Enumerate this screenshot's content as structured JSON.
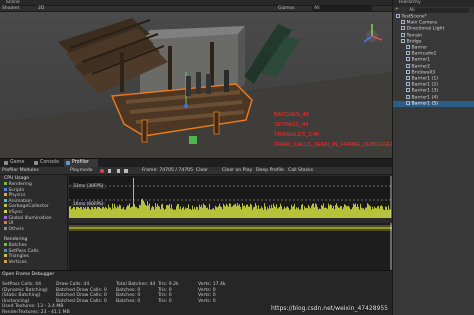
{
  "scene": {
    "tab_label": "Scene",
    "shading_mode": "Shaded",
    "view_mode": "2D",
    "gizmos_label": "Gizmos",
    "search_placeholder": "All",
    "annotations": [
      "BATCHES_48",
      "SETPASS_44",
      "TRIANGLES_3.4K",
      "DRAW_CALLS_SEEN_IN_FRAME_DEBUGGER"
    ],
    "annotation_color": "#ff2a2a"
  },
  "hierarchy": {
    "tab_label": "Hierarchy",
    "search_placeholder": "All",
    "items": [
      {
        "label": "TestScene*",
        "depth": 0,
        "selected": false
      },
      {
        "label": "Main Camera",
        "depth": 1,
        "selected": false
      },
      {
        "label": "Directional Light",
        "depth": 1,
        "selected": false
      },
      {
        "label": "Terrain",
        "depth": 1,
        "selected": false
      },
      {
        "label": "Bridge",
        "depth": 1,
        "selected": false
      },
      {
        "label": "Barrier",
        "depth": 2,
        "selected": false
      },
      {
        "label": "Barricade1",
        "depth": 2,
        "selected": false
      },
      {
        "label": "Barrier1",
        "depth": 2,
        "selected": false
      },
      {
        "label": "Barrier2",
        "depth": 2,
        "selected": false
      },
      {
        "label": "Brickwall3",
        "depth": 2,
        "selected": false
      },
      {
        "label": "Barrier1 (1)",
        "depth": 2,
        "selected": false
      },
      {
        "label": "Barrier1 (2)",
        "depth": 2,
        "selected": false
      },
      {
        "label": "Barrier1 (3)",
        "depth": 2,
        "selected": false
      },
      {
        "label": "Barrier1 (4)",
        "depth": 2,
        "selected": false
      },
      {
        "label": "Barrier1 (5)",
        "depth": 2,
        "selected": true
      }
    ]
  },
  "profiler": {
    "tabs": [
      {
        "label": "Game",
        "icon": "gamepad-icon"
      },
      {
        "label": "Console",
        "icon": "console-icon"
      },
      {
        "label": "Profiler",
        "icon": "profiler-icon"
      }
    ],
    "active_tab": "Profiler",
    "modules_header": "Profiler Modules",
    "playmode": "Playmode",
    "frame_label": "Frame: 74705 / 74705",
    "clear": "Clear",
    "clear_on_play": "Clear on Play",
    "deep_profile": "Deep Profile",
    "call_stacks": "Call Stacks",
    "cpu_label": "CPU Usage",
    "cpu_items": [
      {
        "label": "Rendering",
        "color": "#6dbf4b"
      },
      {
        "label": "Scripts",
        "color": "#4b8bd4"
      },
      {
        "label": "Physics",
        "color": "#e6a92c"
      },
      {
        "label": "Animation",
        "color": "#4bc2c2"
      },
      {
        "label": "GarbageCollector",
        "color": "#c2c24b"
      },
      {
        "label": "VSync",
        "color": "#d2d24b"
      },
      {
        "label": "Global Illumination",
        "color": "#9c6ad6"
      },
      {
        "label": "UI",
        "color": "#d67a4b"
      },
      {
        "label": "Others",
        "color": "#888888"
      }
    ],
    "rendering_label": "Rendering",
    "rendering_items": [
      {
        "label": "Batches",
        "color": "#6dbf4b"
      },
      {
        "label": "SetPass Calls",
        "color": "#4b8bd4"
      },
      {
        "label": "Triangles",
        "color": "#c4c44b"
      },
      {
        "label": "Vertices",
        "color": "#d6a24b"
      }
    ],
    "cpu_marker_30fps": "33ms (30FPS)",
    "cpu_marker_60fps": "16ms (60FPS)",
    "cpu_series_color": "#b6c23a"
  },
  "frame_debugger": {
    "title": "Open Frame Debugger",
    "stats": [
      [
        "SetPass Calls: 44",
        "Draw Calls: 44",
        "Total Batches: 44",
        "Tris: 9.2k",
        "Verts: 17.4k"
      ],
      [
        "(Dynamic Batching)",
        "Batched Draw Calls: 0",
        "Batches: 0",
        "Tris: 0",
        "Verts: 0"
      ],
      [
        "(Static Batching)",
        "Batched Draw Calls: 0",
        "Batches: 0",
        "Tris: 0",
        "Verts: 0"
      ],
      [
        "(Instancing)",
        "Batched Draw Calls: 0",
        "Batches: 0",
        "Tris: 0",
        "Verts: 0"
      ],
      [
        "Used Textures: 13 - 3.4 MB",
        "",
        "",
        "",
        ""
      ],
      [
        "RenderTextures: 23 - 41.1 MB",
        "",
        "",
        "",
        ""
      ]
    ]
  },
  "watermark": "https://blog.csdn.net/weixin_47428955"
}
